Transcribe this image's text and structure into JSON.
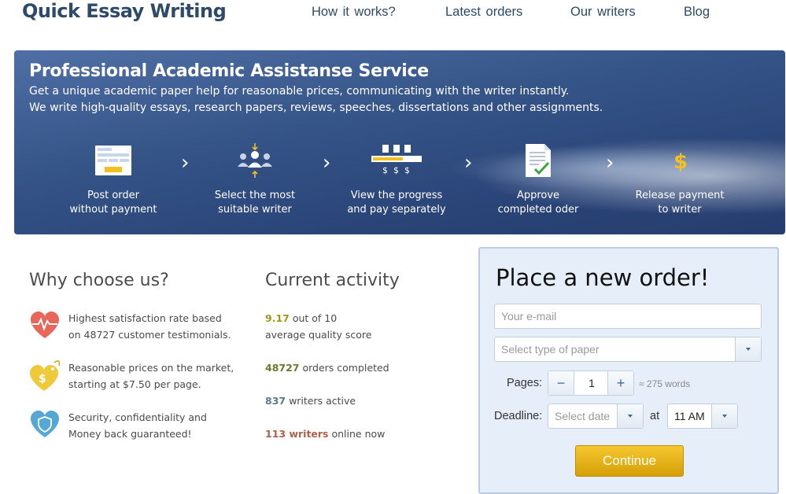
{
  "header": {
    "logo": "Quick Essay Writing",
    "nav": [
      "How  it  works?",
      "Latest  orders",
      "Our  writers",
      "Blog"
    ]
  },
  "hero": {
    "title": "Professional Academic Assistanse Service",
    "line1": "Get a unique academic paper help for reasonable prices, communicating with the writer instantly.",
    "line2": "We write high-quality essays, research papers, reviews, speeches, dissertations and other assignments.",
    "steps": [
      {
        "line1": "Post order",
        "line2": "without payment",
        "icon": "order-form-icon"
      },
      {
        "line1": "Select the most",
        "line2": "suitable writer",
        "icon": "writers-group-icon"
      },
      {
        "line1": "View the progress",
        "line2": "and pay separately",
        "icon": "progress-payment-icon"
      },
      {
        "line1": "Approve",
        "line2": "completed oder",
        "icon": "approved-document-icon"
      },
      {
        "line1": "Release payment",
        "line2": "to writer",
        "icon": "dollar-icon"
      }
    ],
    "arrow": "›"
  },
  "why": {
    "title": "Why choose us?",
    "items": [
      {
        "line1": "Highest satisfaction rate based",
        "line2": "on 48727 customer testimonials.",
        "icon": "heart-pulse-icon"
      },
      {
        "line1": "Reasonable prices on the market,",
        "line2": "starting at $7.50 per page.",
        "icon": "heart-price-tag-icon"
      },
      {
        "line1": "Security, confidentiality and",
        "line2": "Money back guaranteed!",
        "icon": "heart-shield-icon"
      }
    ]
  },
  "activity": {
    "title": "Current activity",
    "score_value": "9.17",
    "score_suffix": " out of 10",
    "score_line2": "average quality score",
    "orders_value": "48727",
    "orders_suffix": " orders completed",
    "writers_value": "837",
    "writers_suffix": " writers active",
    "online_value": "113 writers",
    "online_suffix": " online now"
  },
  "order": {
    "title": "Place a new order!",
    "email_placeholder": "Your e-mail",
    "paper_placeholder": "Select type of paper",
    "pages_label": "Pages:",
    "pages_value": "1",
    "minus": "−",
    "plus": "+",
    "words": "≈ 275 words",
    "deadline_label": "Deadline:",
    "date_placeholder": "Select date",
    "at_label": "at",
    "time_value": "11 AM",
    "continue_label": "Continue"
  },
  "colors": {
    "brand": "#2d4a6a",
    "hero_blue": "#355487",
    "continue": "#e0ad12",
    "form_bg": "#e6eef9"
  }
}
